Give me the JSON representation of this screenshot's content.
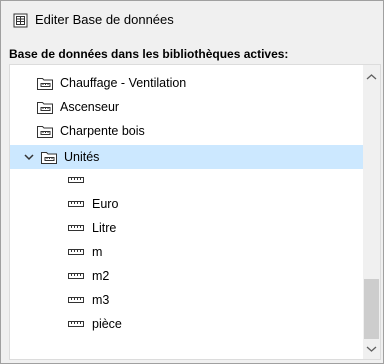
{
  "window": {
    "title": "Editer Base de données",
    "icon": "database-icon"
  },
  "section_label": "Base de données dans les bibliothèques actives:",
  "tree": {
    "folders": [
      {
        "label": "Chauffage - Ventilation",
        "icon": "folder-unit-icon"
      },
      {
        "label": "Ascenseur",
        "icon": "folder-unit-icon"
      },
      {
        "label": "Charpente bois",
        "icon": "folder-unit-icon"
      }
    ],
    "expanded_folder": {
      "label": "Unités",
      "icon": "folder-unit-icon",
      "state": "expanded",
      "selected": true
    },
    "units": [
      {
        "label": ""
      },
      {
        "label": "Euro"
      },
      {
        "label": "Litre"
      },
      {
        "label": "m"
      },
      {
        "label": "m2"
      },
      {
        "label": "m3"
      },
      {
        "label": "pièce"
      }
    ]
  },
  "colors": {
    "selection": "#cce8ff",
    "background": "#f0f0f0",
    "tree_bg": "#ffffff",
    "icon_stroke": "#333333"
  }
}
